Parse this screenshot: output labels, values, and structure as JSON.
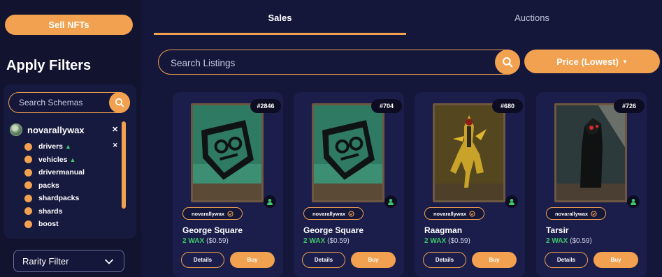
{
  "sidebar": {
    "sell_label": "Sell NFTs",
    "filters_title": "Apply Filters",
    "schema_search_placeholder": "Search Schemas",
    "collection": "novarallywax",
    "schemas": [
      {
        "label": "drivers",
        "verified": true
      },
      {
        "label": "vehicles",
        "verified": true
      },
      {
        "label": "drivermanual",
        "verified": false
      },
      {
        "label": "packs",
        "verified": false
      },
      {
        "label": "shardpacks",
        "verified": false
      },
      {
        "label": "shards",
        "verified": false
      },
      {
        "label": "boost",
        "verified": false
      }
    ],
    "rarity_label": "Rarity Filter"
  },
  "tabs": [
    {
      "label": "Sales",
      "active": true
    },
    {
      "label": "Auctions",
      "active": false
    }
  ],
  "search": {
    "placeholder": "Search Listings"
  },
  "sort": {
    "label": "Price (Lowest)"
  },
  "listings": [
    {
      "id": "#2846",
      "seller": "novarallywax",
      "name": "George Square",
      "price_wax": "2 WAX",
      "price_usd": "($0.59)",
      "art": "george",
      "details_label": "Details",
      "buy_label": "Buy"
    },
    {
      "id": "#704",
      "seller": "novarallywax",
      "name": "George Square",
      "price_wax": "2 WAX",
      "price_usd": "($0.59)",
      "art": "george",
      "details_label": "Details",
      "buy_label": "Buy"
    },
    {
      "id": "#680",
      "seller": "novarallywax",
      "name": "Raagman",
      "price_wax": "2 WAX",
      "price_usd": "($0.59)",
      "art": "raagman",
      "details_label": "Details",
      "buy_label": "Buy"
    },
    {
      "id": "#726",
      "seller": "novarallywax",
      "name": "Tarsir",
      "price_wax": "2 WAX",
      "price_usd": "($0.59)",
      "art": "tarsir",
      "details_label": "Details",
      "buy_label": "Buy"
    }
  ],
  "colors": {
    "accent": "#f1a14f",
    "background": "#14163a",
    "card": "#1b1e4a",
    "price_green": "#3ec96a"
  }
}
